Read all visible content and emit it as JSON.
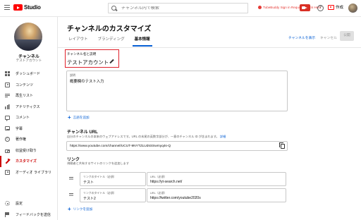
{
  "header": {
    "logo_text": "Studio",
    "search_placeholder": "チャンネル内で検索",
    "notice_text": "TubeBuddy Sign in Required. Click Here",
    "create_label": "作成"
  },
  "sidebar": {
    "channel_name": "チャンネル",
    "channel_sub": "テストアカウント",
    "items": [
      {
        "label": "ダッシュボード",
        "icon": "dashboard-icon"
      },
      {
        "label": "コンテンツ",
        "icon": "content-icon"
      },
      {
        "label": "再生リスト",
        "icon": "playlist-icon"
      },
      {
        "label": "アナリティクス",
        "icon": "analytics-icon"
      },
      {
        "label": "コメント",
        "icon": "comment-icon"
      },
      {
        "label": "字幕",
        "icon": "subtitles-icon"
      },
      {
        "label": "著作権",
        "icon": "copyright-icon"
      },
      {
        "label": "収益受け取り",
        "icon": "monetization-icon"
      },
      {
        "label": "カスタマイズ",
        "icon": "customize-icon",
        "active": true
      },
      {
        "label": "オーディオ ライブラリ",
        "icon": "audio-library-icon"
      }
    ],
    "bottom": [
      {
        "label": "設定",
        "icon": "settings-icon"
      },
      {
        "label": "フィードバックを送信",
        "icon": "feedback-icon"
      }
    ]
  },
  "main": {
    "title": "チャンネルのカスタマイズ",
    "tabs": [
      "レイアウト",
      "ブランディング",
      "基本情報"
    ],
    "active_tab": 2,
    "view_channel": "チャンネルを表示",
    "cancel": "キャンセル",
    "publish": "公開",
    "name_section": {
      "label": "チャンネル名と説明",
      "value": "テストアカウント"
    },
    "description": {
      "label": "説明",
      "value": "概要欄のテスト入力"
    },
    "add_language": "言語を追加",
    "url_section": {
      "title": "チャンネル URL",
      "desc": "自分のチャンネルの本来のウェブアドレスです。URL の末尾の英数字部分が、一意のチャンネル ID が含まれます。",
      "detail_link": "詳細",
      "value": "https://www.youtube.com/channel/UCUT-9NYTZLUdsSSwmyq4s-Q"
    },
    "links_section": {
      "title": "リンク",
      "desc": "視聴者と共有するサイトのリンクを追加します",
      "rows": [
        {
          "title_label": "リンクのタイトル（必須）",
          "title_value": "テスト",
          "url_label": "URL（必須）",
          "url_value": "https://yt-search.net/"
        },
        {
          "title_label": "リンクのタイトル（必須）",
          "title_value": "テスト2",
          "url_label": "URL（必須）",
          "url_value": "https://twitter.com/youtube2020s"
        }
      ],
      "add_link": "リンクを追加"
    }
  },
  "colors": {
    "accent_red": "#cc0000",
    "link_blue": "#065fd4",
    "highlight_border": "#e0202a"
  }
}
